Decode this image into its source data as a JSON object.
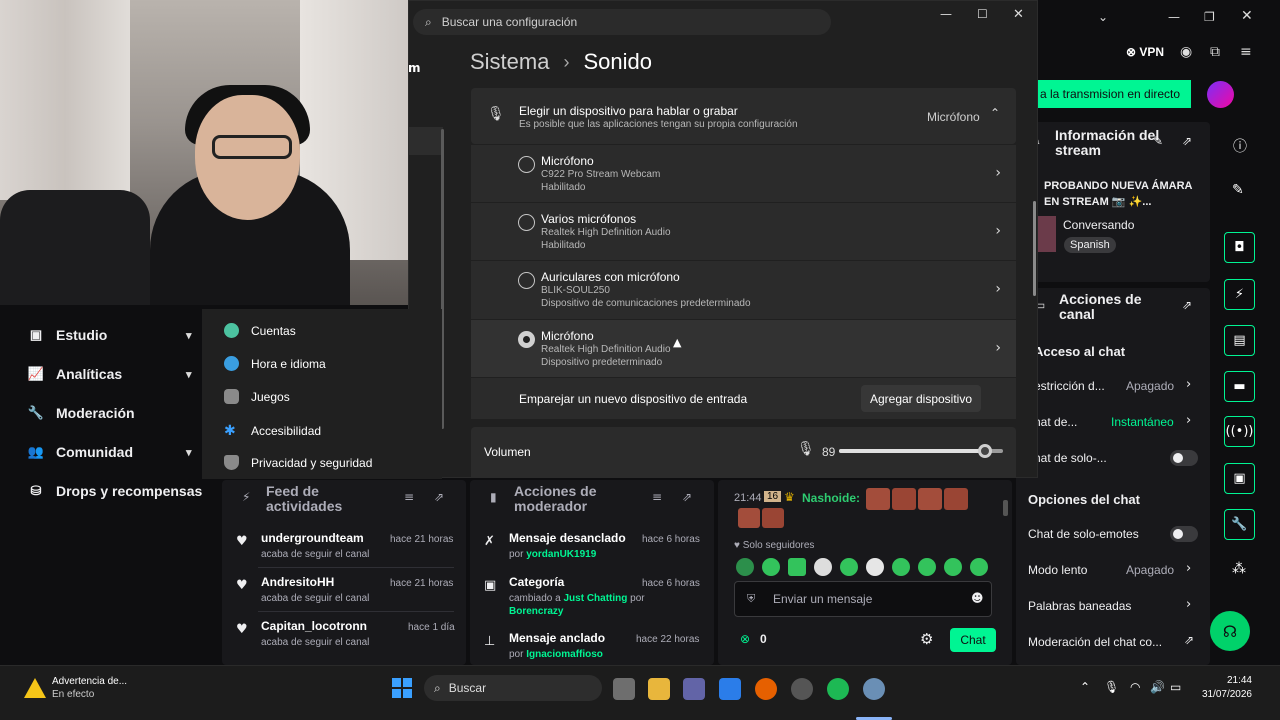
{
  "leftnav": {
    "items": [
      {
        "label": "Estudio",
        "chev": "⌄"
      },
      {
        "label": "Analíticas",
        "chev": "⌄"
      },
      {
        "label": "Moderación",
        "chev": ""
      },
      {
        "label": "Comunidad",
        "chev": "⌄"
      },
      {
        "label": "Drops y recompensas",
        "chev": ""
      }
    ]
  },
  "settings": {
    "search_placeholder": "Buscar una configuración",
    "crumb_parent": "Sistema",
    "crumb_sep": "›",
    "crumb_current": "Sonido",
    "choose_title": "Elegir un dispositivo para hablar o grabar",
    "choose_sub": "Es posible que las aplicaciones tengan su propia configuración",
    "choose_value": "Micrófono",
    "devices": [
      {
        "name": "Micrófono",
        "l1": "C922 Pro Stream Webcam",
        "l2": "Habilitado",
        "selected": false
      },
      {
        "name": "Varios micrófonos",
        "l1": "Realtek High Definition Audio",
        "l2": "Habilitado",
        "selected": false
      },
      {
        "name": "Auriculares con micrófono",
        "l1": "BLIK-SOUL250",
        "l2": "Dispositivo de comunicaciones predeterminado",
        "selected": false
      },
      {
        "name": "Micrófono",
        "l1": "Realtek High Definition Audio",
        "l2": "Dispositivo predeterminado",
        "selected": true
      }
    ],
    "pair_label": "Emparejar un nuevo dispositivo de entrada",
    "pair_button": "Agregar dispositivo",
    "volume_label": "Volumen",
    "volume_value": "89",
    "volume_level": 0.89,
    "nav": [
      {
        "label": "Cuentas",
        "color": "#4cc2a0"
      },
      {
        "label": "Hora e idioma",
        "color": "#3a9ee0"
      },
      {
        "label": "Juegos",
        "color": "#8a8a8a"
      },
      {
        "label": "Accesibilidad",
        "color": "#3aa0ff"
      },
      {
        "label": "Privacidad y seguridad",
        "color": "#8a8a8a"
      }
    ]
  },
  "right": {
    "vpn": "VPN",
    "live_banner": "a la transmision en directo",
    "info_title": "Información del stream",
    "stream_title": "PROBANDO NUEVA ÁMARA EN STREAM 📷 ✨...",
    "category": "Conversando",
    "tag": "Spanish",
    "actions_title": "Acciones de canal",
    "chat_access": "Acceso al chat",
    "rows": [
      {
        "label": "estricción d...",
        "value": "Apagado"
      },
      {
        "label": "hat de...",
        "value": "Instantáneo"
      },
      {
        "label": "hat de solo-...",
        "value": ""
      }
    ],
    "chat_options": "Opciones del chat",
    "rows2": [
      {
        "label": "Chat de solo-emotes",
        "value": ""
      },
      {
        "label": "Modo lento",
        "value": "Apagado"
      },
      {
        "label": "Palabras baneadas",
        "value": ""
      },
      {
        "label": "Moderación del chat co...",
        "value": ""
      }
    ]
  },
  "feed": {
    "title": "Feed de actividades",
    "items": [
      {
        "name": "undergroundteam",
        "sub": "acaba de seguir el canal",
        "time": "hace 21 horas"
      },
      {
        "name": "AndresitoHH",
        "sub": "acaba de seguir el canal",
        "time": "hace 21 horas"
      },
      {
        "name": "Capitan_locotronn",
        "sub": "acaba de seguir el canal",
        "time": "hace 1 día"
      }
    ]
  },
  "modactions": {
    "title": "Acciones de moderador",
    "items": [
      {
        "name": "Mensaje desanclado",
        "sub1": "por ",
        "sub2": "yordanUK1919",
        "sub3": "",
        "sub4": "",
        "time": "hace 6 horas"
      },
      {
        "name": "Categoría",
        "sub1": "cambiado a ",
        "sub2": "Just Chatting",
        "sub3": " por",
        "sub4": "Borencrazy",
        "time": "hace 6 horas"
      },
      {
        "name": "Mensaje anclado",
        "sub1": "por ",
        "sub2": "Ignaciomaffioso",
        "sub3": "",
        "sub4": "",
        "time": "hace 22 horas"
      }
    ]
  },
  "chat": {
    "time": "21:44",
    "badge": "16",
    "user": "Nashoide",
    "followers": "Solo seguidores",
    "placeholder": "Enviar un mensaje",
    "points": "0",
    "send": "Chat"
  },
  "taskbar": {
    "alert_title": "Advertencia de...",
    "alert_sub": "En efecto",
    "search": "Buscar",
    "time": "21:44",
    "date": "31/07/2026"
  }
}
